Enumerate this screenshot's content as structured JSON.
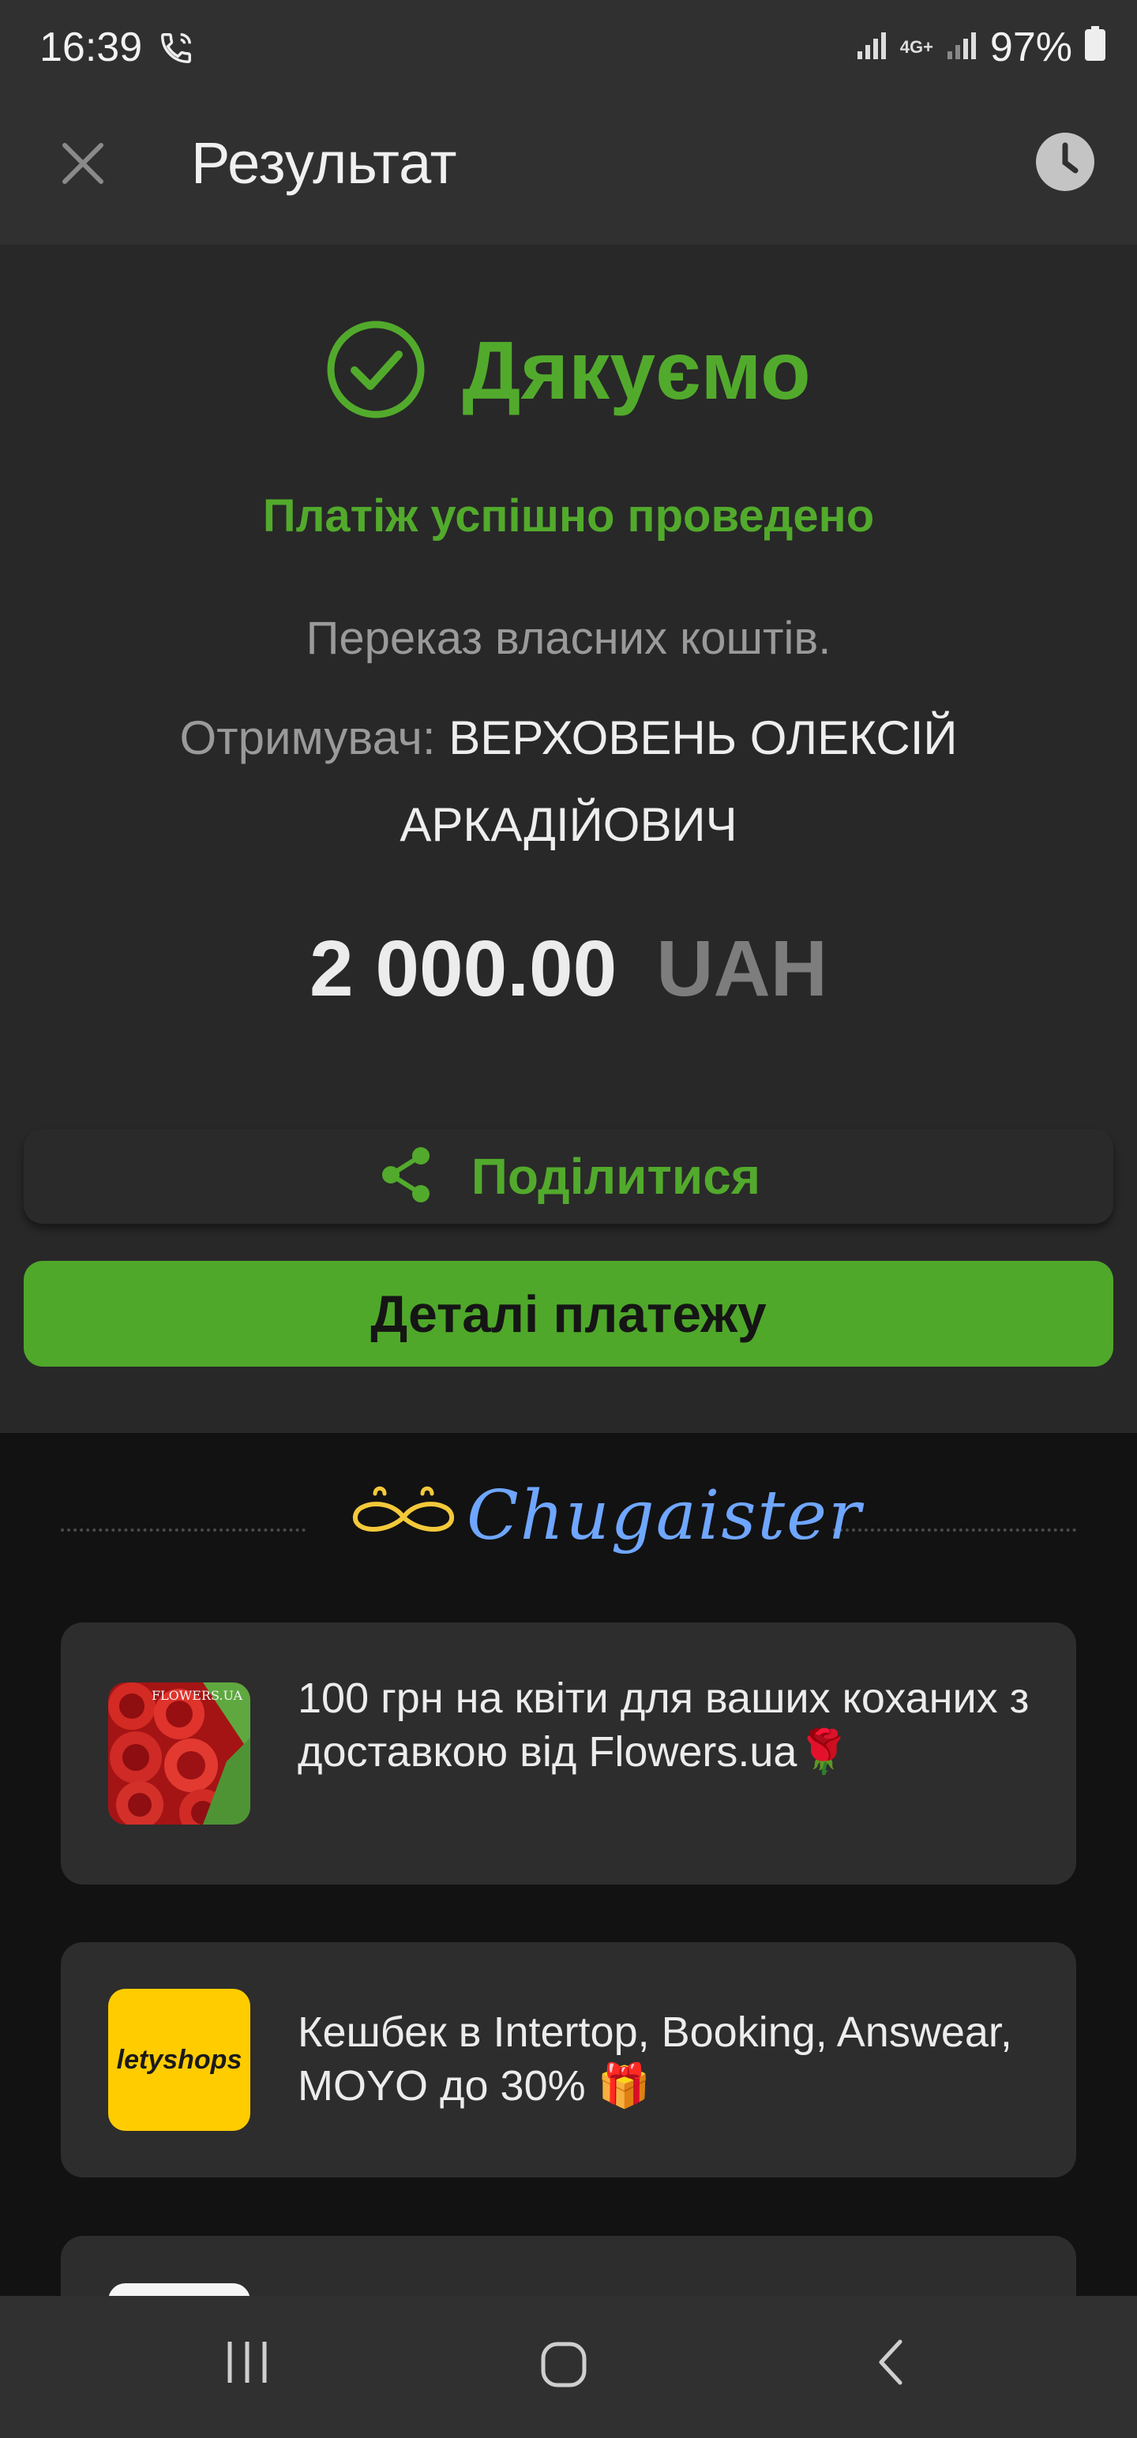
{
  "status_bar": {
    "time": "16:39",
    "battery": "97%",
    "network": "4G+"
  },
  "header": {
    "title": "Результат"
  },
  "result": {
    "thanks": "Дякуємо",
    "success": "Платіж успішно проведено",
    "description": "Переказ власних коштів.",
    "recipient_label": "Отримувач:",
    "recipient_name": "ВЕРХОВЕНЬ ОЛЕКСІЙ АРКАДІЙОВИЧ",
    "amount": "2 000.00",
    "currency": "UAH"
  },
  "actions": {
    "share_label": "Поділитися",
    "details_label": "Деталі платежу"
  },
  "chugaister": {
    "brand": "Chugaister"
  },
  "promos": [
    {
      "text": "100 грн на квіти для ваших коханих з доставкою від Flowers.ua",
      "emoji": "🌹",
      "badge": "FLOWERS.UA"
    },
    {
      "text": "Кешбек в Intertop, Booking, Answear, MOYO до 30%",
      "emoji": "🎁",
      "badge": "letyshops"
    }
  ],
  "colors": {
    "accent": "#52aa2c",
    "button": "#4fa82a",
    "chugaister": "#6fa6ff",
    "mustache": "#f3c93a"
  }
}
